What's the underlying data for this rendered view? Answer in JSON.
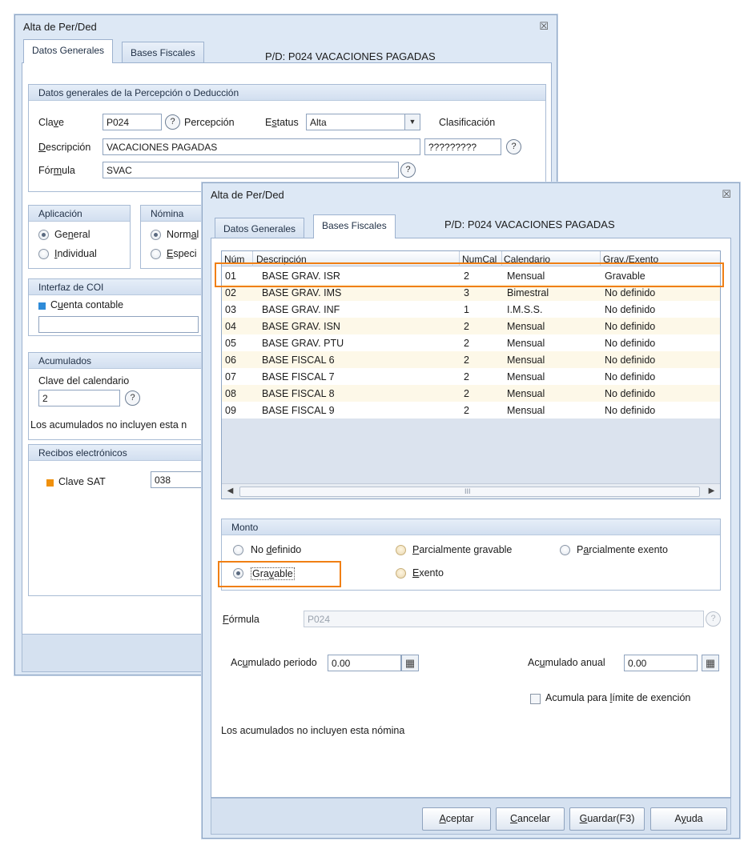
{
  "back": {
    "title": "Alta de Per/Ded",
    "close": "☒",
    "tabs": [
      "Datos Generales",
      "Bases Fiscales"
    ],
    "pd_label": "P/D: P024  VACACIONES PAGADAS",
    "general_group": {
      "title": "Datos generales de la Percepción o Deducción",
      "clave_label_pre": "Cla",
      "clave_label_u": "v",
      "clave_label_post": "e",
      "clave_value": "P024",
      "help": "?",
      "tipo_label": "Percepción",
      "estatus_label_pre": "E",
      "estatus_label_u": "s",
      "estatus_label_post": "tatus",
      "estatus_value": "Alta",
      "dropdown": "▼",
      "clasificacion_label": "Clasificación",
      "descripcion_label_pre": "",
      "descripcion_label_u": "D",
      "descripcion_label_post": "escripción",
      "descripcion_value": "VACACIONES PAGADAS",
      "clasificacion_value": "?????????",
      "formula_label_pre": "Fór",
      "formula_label_u": "m",
      "formula_label_post": "ula",
      "formula_value": "SVAC"
    },
    "aplicacion": {
      "title": "Aplicación",
      "general_pre": "Ge",
      "general_u": "n",
      "general_post": "eral",
      "individual_pre": "",
      "individual_u": "I",
      "individual_post": "ndividual"
    },
    "nomina": {
      "title": "Nómina",
      "normal_pre": "Norm",
      "normal_u": "a",
      "normal_post": "l",
      "especi_pre": "",
      "especi_u": "E",
      "especi_post": "speci"
    },
    "coi": {
      "title": "Interfaz de COI",
      "cuenta_pre": "C",
      "cuenta_u": "u",
      "cuenta_post": "enta contable",
      "color": "#2e8bd8"
    },
    "acumulados": {
      "title": "Acumulados",
      "clave_cal_label": "Clave del calendario",
      "clave_cal_value": "2",
      "note": "Los acumulados no incluyen esta n"
    },
    "recibos": {
      "title": "Recibos electrónicos",
      "clave_sat_label": "Clave SAT",
      "clave_sat_value": "038",
      "color": "#f0900c"
    }
  },
  "front": {
    "title": "Alta de Per/Ded",
    "close": "☒",
    "tabs": [
      "Datos Generales",
      "Bases Fiscales"
    ],
    "pd_label": "P/D: P024  VACACIONES PAGADAS",
    "grid": {
      "columns": [
        "Núm",
        "Descripción",
        "NumCal",
        "Calendario",
        "Grav./Exento"
      ],
      "rows": [
        {
          "num": "01",
          "desc": "BASE GRAV. ISR",
          "numcal": "2",
          "cal": "Mensual",
          "grav": "Gravable"
        },
        {
          "num": "02",
          "desc": "BASE GRAV. IMS",
          "numcal": "3",
          "cal": "Bimestral",
          "grav": "No definido"
        },
        {
          "num": "03",
          "desc": "BASE GRAV. INF",
          "numcal": "1",
          "cal": "I.M.S.S.",
          "grav": "No definido"
        },
        {
          "num": "04",
          "desc": "BASE GRAV. ISN",
          "numcal": "2",
          "cal": "Mensual",
          "grav": "No definido"
        },
        {
          "num": "05",
          "desc": "BASE GRAV. PTU",
          "numcal": "2",
          "cal": "Mensual",
          "grav": "No definido"
        },
        {
          "num": "06",
          "desc": "BASE FISCAL 6",
          "numcal": "2",
          "cal": "Mensual",
          "grav": "No definido"
        },
        {
          "num": "07",
          "desc": "BASE FISCAL 7",
          "numcal": "2",
          "cal": "Mensual",
          "grav": "No definido"
        },
        {
          "num": "08",
          "desc": "BASE FISCAL 8",
          "numcal": "2",
          "cal": "Mensual",
          "grav": "No definido"
        },
        {
          "num": "09",
          "desc": "BASE FISCAL 9",
          "numcal": "2",
          "cal": "Mensual",
          "grav": "No definido"
        }
      ],
      "scroll_left": "◀",
      "scroll_right": "▶",
      "grip": "III"
    },
    "monto": {
      "title": "Monto",
      "no_definido_pre": "No ",
      "no_definido_u": "d",
      "no_definido_post": "efinido",
      "parcial_grav_pre": "",
      "parcial_grav_u": "P",
      "parcial_grav_post": "arcialmente gravable",
      "parcial_exento_pre": "P",
      "parcial_exento_u": "a",
      "parcial_exento_post": "rcialmente exento",
      "gravable_pre": "Gra",
      "gravable_u": "v",
      "gravable_post": "able",
      "exento_pre": "",
      "exento_u": "E",
      "exento_post": "xento",
      "selected": "Gravable"
    },
    "formula": {
      "label_pre": "",
      "label_u": "F",
      "label_post": "órmula",
      "value": "P024",
      "help": "?"
    },
    "acum_periodo": {
      "label_pre": "Ac",
      "label_u": "u",
      "label_post": "mulado periodo",
      "value": "0.00"
    },
    "acum_anual": {
      "label_pre": "Ac",
      "label_u": "u",
      "label_post": "mulado anual",
      "value": "0.00"
    },
    "calc_icon": "▦",
    "acumula_limite": {
      "label_pre": "Acumula para ",
      "label_u": "l",
      "label_post": "ímite de exención"
    },
    "note": "Los acumulados no incluyen esta nómina",
    "buttons": {
      "aceptar_pre": "",
      "aceptar_u": "A",
      "aceptar_post": "ceptar",
      "cancelar_pre": "",
      "cancelar_u": "C",
      "cancelar_post": "ancelar",
      "guardar_pre": "",
      "guardar_u": "G",
      "guardar_post": "uardar(F3)",
      "ayuda_pre": "A",
      "ayuda_u": "y",
      "ayuda_post": "uda"
    },
    "highlight_color": "#f07f14"
  }
}
